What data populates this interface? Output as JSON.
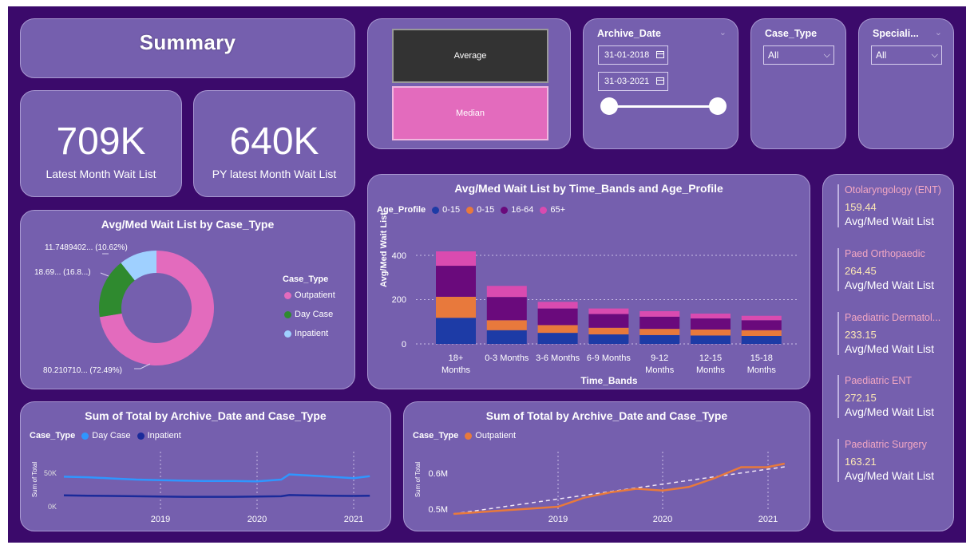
{
  "summary": {
    "title": "Summary"
  },
  "kpis": [
    {
      "value": "709K",
      "label": "Latest Month Wait List"
    },
    {
      "value": "640K",
      "label": "PY latest Month Wait List"
    }
  ],
  "toggle": {
    "average_label": "Average",
    "median_label": "Median"
  },
  "archive_date": {
    "title": "Archive_Date",
    "start": "31-01-2018",
    "end": "31-03-2021"
  },
  "case_type_slicer": {
    "title": "Case_Type",
    "value": "All"
  },
  "specialty_slicer": {
    "title": "Speciali...",
    "value": "All"
  },
  "donut": {
    "title": "Avg/Med Wait List by Case_Type",
    "legend_title": "Case_Type",
    "labels": {
      "inpatient": "11.7489402... (10.62%)",
      "daycase": "18.69... (16.8...)",
      "outpatient": "80.210710... (72.49%)"
    }
  },
  "bar_chart_meta": {
    "title": "Avg/Med Wait List by Time_Bands and Age_Profile",
    "legend_title": "Age_Profile",
    "xlabel": "Time_Bands",
    "ylabel": "Avg/Med Wait List",
    "tick_labels_y": [
      "400",
      "200",
      "0"
    ],
    "x_labels": [
      [
        "18+",
        "Months"
      ],
      [
        "0-3 Months",
        ""
      ],
      [
        "3-6 Months",
        ""
      ],
      [
        "6-9 Months",
        ""
      ],
      [
        "9-12",
        "Months"
      ],
      [
        "12-15",
        "Months"
      ],
      [
        "15-18",
        "Months"
      ]
    ]
  },
  "line1": {
    "title": "Sum of Total by Archive_Date and Case_Type",
    "legend_title": "Case_Type",
    "legend": [
      "Day Case",
      "Inpatient"
    ],
    "ylabel": "Sum of Total",
    "yticks": [
      "50K",
      "0K"
    ],
    "xticks": [
      "2019",
      "2020",
      "2021"
    ]
  },
  "line2": {
    "title": "Sum of Total by Archive_Date and Case_Type",
    "legend_title": "Case_Type",
    "legend": [
      "Outpatient"
    ],
    "ylabel": "Sum of Total",
    "yticks": [
      "0.6M",
      "0.5M"
    ],
    "xticks": [
      "2019",
      "2020",
      "2021"
    ]
  },
  "specialties": [
    {
      "name": "Otolaryngology (ENT)",
      "value": "159.44",
      "label": "Avg/Med Wait List"
    },
    {
      "name": "Paed Orthopaedic",
      "value": "264.45",
      "label": "Avg/Med Wait List"
    },
    {
      "name": "Paediatric Dermatol...",
      "value": "233.15",
      "label": "Avg/Med Wait List"
    },
    {
      "name": "Paediatric ENT",
      "value": "272.15",
      "label": "Avg/Med Wait List"
    },
    {
      "name": "Paediatric Surgery",
      "value": "163.21",
      "label": "Avg/Med Wait List"
    }
  ],
  "colors": {
    "background": "#3b0a6b",
    "card": "#755fae",
    "outpatient": "#e36bbd",
    "daycase": "#2f8a2f",
    "inpatient": "#9fd0ff",
    "age_0_15_a": "#1d3ba6",
    "age_0_15_b": "#e8793c",
    "age_16_64": "#6a0a7c",
    "age_65_plus": "#d94bb0",
    "line_daycase": "#2f96ff",
    "line_inpatient": "#1a2a9a",
    "line_outpatient": "#e8793c"
  },
  "chart_data": [
    {
      "type": "pie",
      "title": "Avg/Med Wait List by Case_Type",
      "categories": [
        "Outpatient",
        "Day Case",
        "Inpatient"
      ],
      "values": [
        80.21,
        18.69,
        11.75
      ],
      "percent": [
        72.49,
        16.89,
        10.62
      ]
    },
    {
      "type": "bar",
      "stacked": true,
      "title": "Avg/Med Wait List by Time_Bands and Age_Profile",
      "categories": [
        "18+ Months",
        "0-3 Months",
        "3-6 Months",
        "6-9 Months",
        "9-12 Months",
        "12-15 Months",
        "15-18 Months"
      ],
      "series": [
        {
          "name": "0-15",
          "values": [
            118,
            62,
            50,
            43,
            40,
            38,
            36
          ]
        },
        {
          "name": "0-15",
          "values": [
            95,
            45,
            35,
            30,
            28,
            27,
            26
          ]
        },
        {
          "name": "16-64",
          "values": [
            140,
            105,
            75,
            62,
            55,
            50,
            45
          ]
        },
        {
          "name": "65+",
          "values": [
            65,
            50,
            30,
            25,
            25,
            22,
            20
          ]
        }
      ],
      "ylim": [
        0,
        440
      ],
      "xlabel": "Time_Bands",
      "ylabel": "Avg/Med Wait List"
    },
    {
      "type": "line",
      "title": "Sum of Total by Archive_Date and Case_Type",
      "x": [
        "2018-01",
        "2018-04",
        "2018-07",
        "2018-10",
        "2019-01",
        "2019-04",
        "2019-07",
        "2019-10",
        "2020-01",
        "2020-04",
        "2020-05",
        "2020-07",
        "2020-10",
        "2021-01",
        "2021-03"
      ],
      "series": [
        {
          "name": "Day Case",
          "values": [
            110,
            108,
            104,
            100,
            98,
            96,
            95,
            95,
            94,
            100,
            118,
            115,
            110,
            105,
            112
          ]
        },
        {
          "name": "Inpatient",
          "values": [
            45,
            44,
            43,
            42,
            41,
            40,
            40,
            40,
            41,
            42,
            46,
            45,
            44,
            43,
            44
          ]
        }
      ],
      "ylim": [
        0,
        140
      ]
    },
    {
      "type": "line",
      "title": "Sum of Total by Archive_Date and Case_Type",
      "x": [
        "2018-01",
        "2018-04",
        "2018-07",
        "2018-10",
        "2019-01",
        "2019-04",
        "2019-07",
        "2019-10",
        "2020-01",
        "2020-04",
        "2020-07",
        "2020-10",
        "2021-01",
        "2021-03"
      ],
      "series": [
        {
          "name": "Outpatient",
          "values": [
            0.5,
            0.505,
            0.51,
            0.515,
            0.52,
            0.545,
            0.56,
            0.57,
            0.565,
            0.575,
            0.6,
            0.63,
            0.63,
            0.64
          ]
        }
      ],
      "ylim": [
        0.48,
        0.66
      ]
    }
  ]
}
